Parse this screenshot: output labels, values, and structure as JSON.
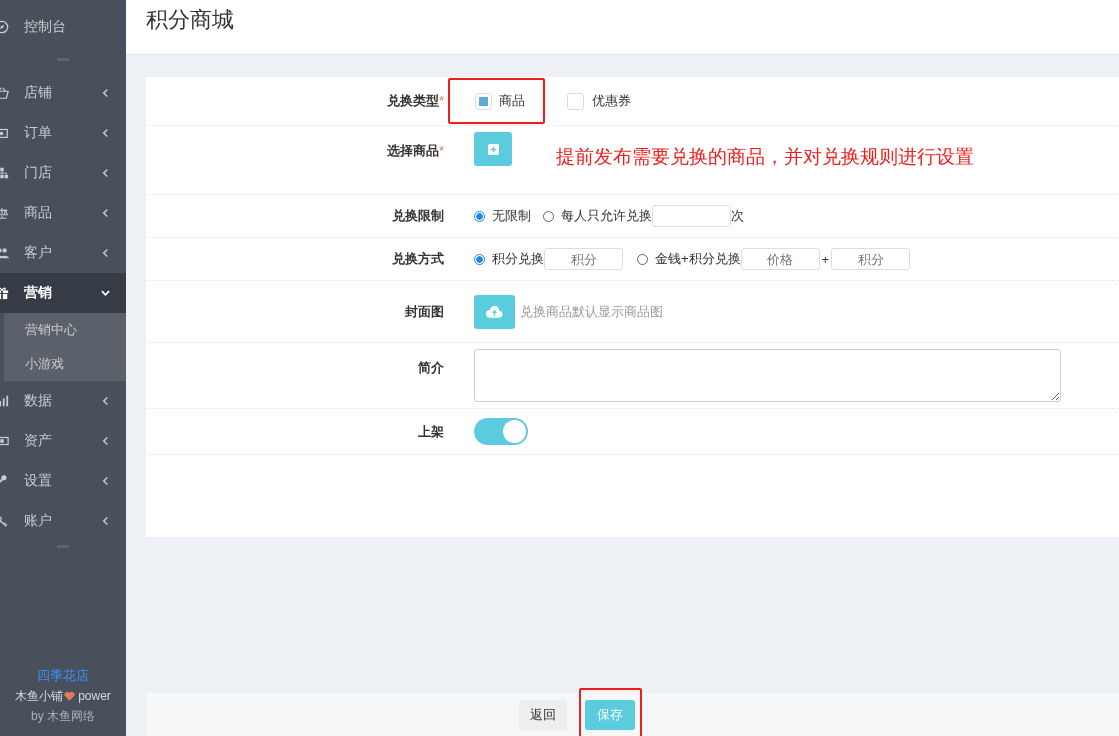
{
  "page_title": "积分商城",
  "sidebar": {
    "items": [
      {
        "label": "控制台",
        "expandable": false,
        "expanded": false,
        "selected": false
      },
      {
        "label": "店铺",
        "expandable": true,
        "expanded": false,
        "selected": false
      },
      {
        "label": "订单",
        "expandable": true,
        "expanded": false,
        "selected": false
      },
      {
        "label": "门店",
        "expandable": true,
        "expanded": false,
        "selected": false
      },
      {
        "label": "商品",
        "expandable": true,
        "expanded": false,
        "selected": false
      },
      {
        "label": "客户",
        "expandable": true,
        "expanded": false,
        "selected": false
      },
      {
        "label": "营销",
        "expandable": true,
        "expanded": true,
        "selected": true,
        "children": [
          {
            "label": "营销中心"
          },
          {
            "label": "小游戏"
          }
        ]
      },
      {
        "label": "数据",
        "expandable": true,
        "expanded": false,
        "selected": false
      },
      {
        "label": "资产",
        "expandable": true,
        "expanded": false,
        "selected": false
      },
      {
        "label": "设置",
        "expandable": true,
        "expanded": false,
        "selected": false
      },
      {
        "label": "账户",
        "expandable": true,
        "expanded": false,
        "selected": false
      }
    ],
    "shop_name": "四季花店",
    "powered_brand": "木鱼小铺",
    "powered_word": "power",
    "by_line": "by 木鱼网络"
  },
  "form": {
    "exchange_type": {
      "label": "兑换类型",
      "required": "*",
      "options": [
        {
          "label": "商品",
          "checked": true
        },
        {
          "label": "优惠券",
          "checked": false
        }
      ]
    },
    "select_goods": {
      "label": "选择商品",
      "required": "*"
    },
    "annotation": "提前发布需要兑换的商品，并对兑换规则进行设置",
    "limit": {
      "label": "兑换限制",
      "options": [
        {
          "label": "无限制",
          "selected": true
        },
        {
          "label": "每人只允许兑换",
          "selected": false
        }
      ],
      "suffix": "次"
    },
    "method": {
      "label": "兑换方式",
      "options": [
        {
          "label": "积分兑换",
          "selected": true
        },
        {
          "label": "金钱+积分兑换",
          "selected": false
        }
      ],
      "points_placeholder": "积分",
      "price_placeholder": "价格",
      "plus": "+",
      "points2_placeholder": "积分"
    },
    "cover": {
      "label": "封面图",
      "hint": "兑换商品默认显示商品图"
    },
    "intro": {
      "label": "简介"
    },
    "shelf": {
      "label": "上架",
      "on": true
    }
  },
  "footer": {
    "back": "返回",
    "save": "保存"
  }
}
